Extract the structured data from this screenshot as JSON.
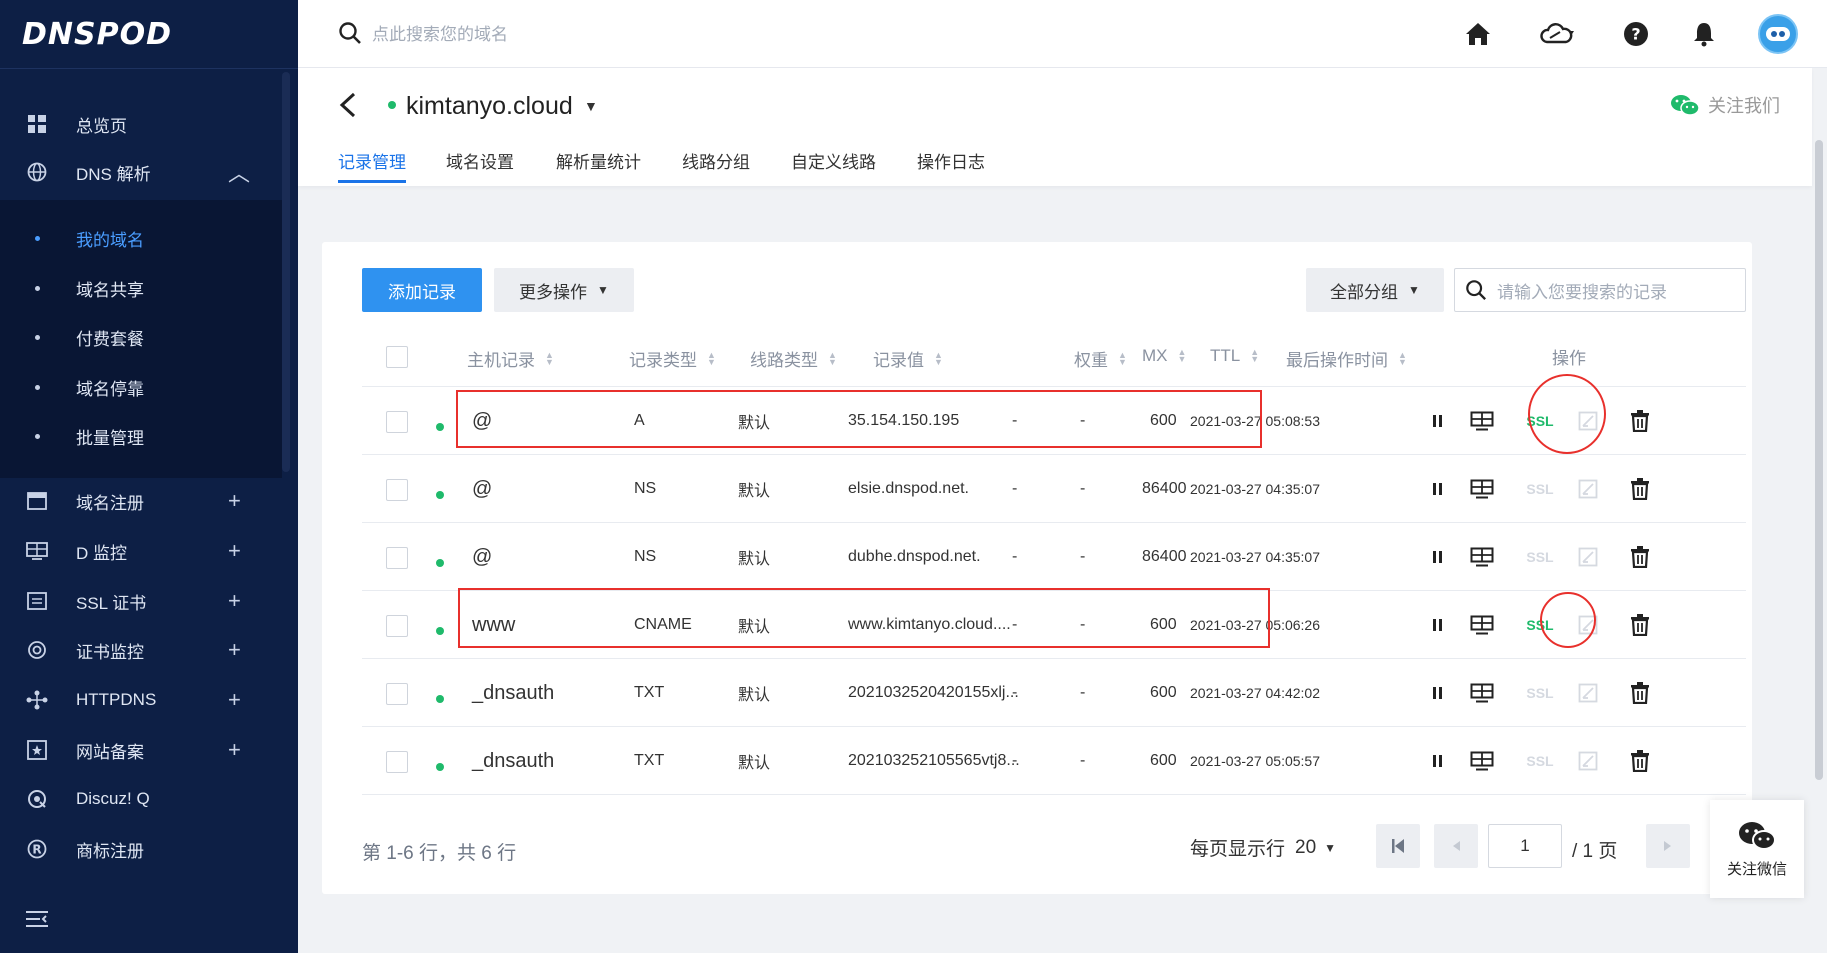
{
  "brand": {
    "logo": "DNSPOD"
  },
  "sidebar": {
    "items": [
      {
        "label": "总览页",
        "icon": "dashboard-icon",
        "action": ""
      },
      {
        "label": "DNS 解析",
        "icon": "globe-icon",
        "action": "︿"
      },
      {
        "label": "域名注册",
        "icon": "calendar-icon",
        "action": "+"
      },
      {
        "label": "D 监控",
        "icon": "monitor-icon",
        "action": "+"
      },
      {
        "label": "SSL 证书",
        "icon": "certificate-icon",
        "action": "+"
      },
      {
        "label": "证书监控",
        "icon": "target-icon",
        "action": "+"
      },
      {
        "label": "HTTPDNS",
        "icon": "network-icon",
        "action": "+"
      },
      {
        "label": "网站备案",
        "icon": "star-box-icon",
        "action": "+"
      },
      {
        "label": "Discuz! Q",
        "icon": "discuz-icon",
        "action": ""
      },
      {
        "label": "商标注册",
        "icon": "registered-icon",
        "action": ""
      }
    ],
    "subitems": [
      {
        "label": "我的域名",
        "active": true
      },
      {
        "label": "域名共享"
      },
      {
        "label": "付费套餐"
      },
      {
        "label": "域名停靠"
      },
      {
        "label": "批量管理"
      }
    ]
  },
  "topbar": {
    "search_placeholder": "点此搜索您的域名"
  },
  "domain": {
    "name": "kimtanyo.cloud",
    "follow_label": "关注我们"
  },
  "tabs": [
    "记录管理",
    "域名设置",
    "解析量统计",
    "线路分组",
    "自定义线路",
    "操作日志"
  ],
  "toolbar": {
    "add_label": "添加记录",
    "more_label": "更多操作",
    "group_label": "全部分组",
    "search_placeholder": "请输入您要搜索的记录"
  },
  "table": {
    "headers": {
      "host": "主机记录",
      "type": "记录类型",
      "line": "线路类型",
      "value": "记录值",
      "weight": "权重",
      "mx": "MX",
      "ttl": "TTL",
      "time": "最后操作时间",
      "ops": "操作"
    },
    "rows": [
      {
        "host": "@",
        "type": "A",
        "line": "默认",
        "value": "35.154.150.195",
        "weight": "-",
        "mx": "-",
        "ttl": "600",
        "time": "2021-03-27 05:08:53",
        "ssl": "SSL",
        "ssl_active": true
      },
      {
        "host": "@",
        "type": "NS",
        "line": "默认",
        "value": "elsie.dnspod.net.",
        "weight": "-",
        "mx": "-",
        "ttl": "86400",
        "time": "2021-03-27 04:35:07",
        "ssl": "SSL",
        "ssl_active": false
      },
      {
        "host": "@",
        "type": "NS",
        "line": "默认",
        "value": "dubhe.dnspod.net.",
        "weight": "-",
        "mx": "-",
        "ttl": "86400",
        "time": "2021-03-27 04:35:07",
        "ssl": "SSL",
        "ssl_active": false
      },
      {
        "host": "www",
        "type": "CNAME",
        "line": "默认",
        "value": "www.kimtanyo.cloud....",
        "weight": "-",
        "mx": "-",
        "ttl": "600",
        "time": "2021-03-27 05:06:26",
        "ssl": "SSL",
        "ssl_active": true
      },
      {
        "host": "_dnsauth",
        "type": "TXT",
        "line": "默认",
        "value": "2021032520420155xlj...",
        "weight": "-",
        "mx": "-",
        "ttl": "600",
        "time": "2021-03-27 04:42:02",
        "ssl": "SSL",
        "ssl_active": false
      },
      {
        "host": "_dnsauth",
        "type": "TXT",
        "line": "默认",
        "value": "202103252105565vtj8...",
        "weight": "-",
        "mx": "-",
        "ttl": "600",
        "time": "2021-03-27 05:05:57",
        "ssl": "SSL",
        "ssl_active": false
      }
    ]
  },
  "footer": {
    "count_label": "第 1-6 行，共 6 行",
    "per_page_label": "每页显示行",
    "per_page_value": "20",
    "current_page": "1",
    "total_pages_label": "/ 1 页"
  },
  "wechat_float": {
    "label": "关注微信"
  },
  "colors": {
    "accent": "#2f92f0",
    "sidebar_bg": "#0d1f45",
    "status_green": "#1fba6b",
    "highlight_red": "#e8302c"
  }
}
